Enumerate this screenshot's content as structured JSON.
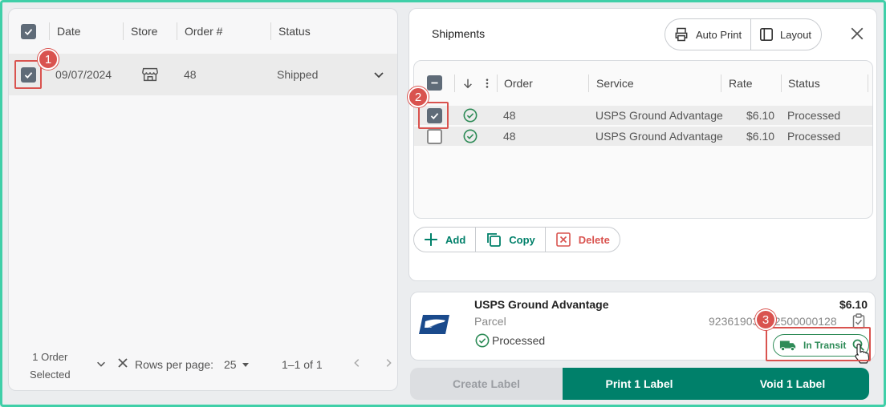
{
  "orders": {
    "columns": [
      "Date",
      "Store",
      "Order #",
      "Status"
    ],
    "rows": [
      {
        "date": "09/07/2024",
        "store_icon": "store-icon",
        "order": "48",
        "status": "Shipped"
      }
    ],
    "footer": {
      "selected_line1": "1 Order",
      "selected_line2": "Selected",
      "rows_per_page_label": "Rows per page:",
      "rows_per_page_value": "25",
      "range": "1–1 of 1"
    }
  },
  "shipments": {
    "title": "Shipments",
    "auto_print": "Auto Print",
    "layout": "Layout",
    "columns": [
      "Order",
      "Service",
      "Rate",
      "Status"
    ],
    "rows": [
      {
        "order": "48",
        "service": "USPS Ground Advantage",
        "rate": "$6.10",
        "status": "Processed",
        "checked": true
      },
      {
        "order": "48",
        "service": "USPS Ground Advantage",
        "rate": "$6.10",
        "status": "Processed",
        "checked": false
      }
    ],
    "actions": {
      "add": "Add",
      "copy": "Copy",
      "delete": "Delete"
    }
  },
  "label_card": {
    "service": "USPS Ground Advantage",
    "package": "Parcel",
    "status": "Processed",
    "price": "$6.10",
    "tracking": "92361903 372500000128",
    "tracking_status": "In Transit"
  },
  "buttons": {
    "create": "Create Label",
    "print": "Print 1 Label",
    "void": "Void 1 Label"
  },
  "callouts": [
    "1",
    "2",
    "3"
  ],
  "colors": {
    "accent": "#00806a",
    "checkbox": "#5f6b78",
    "success": "#2e8b57",
    "danger": "#d9534f",
    "callout": "#d9534f",
    "usps_blue": "#1a4a8c"
  }
}
